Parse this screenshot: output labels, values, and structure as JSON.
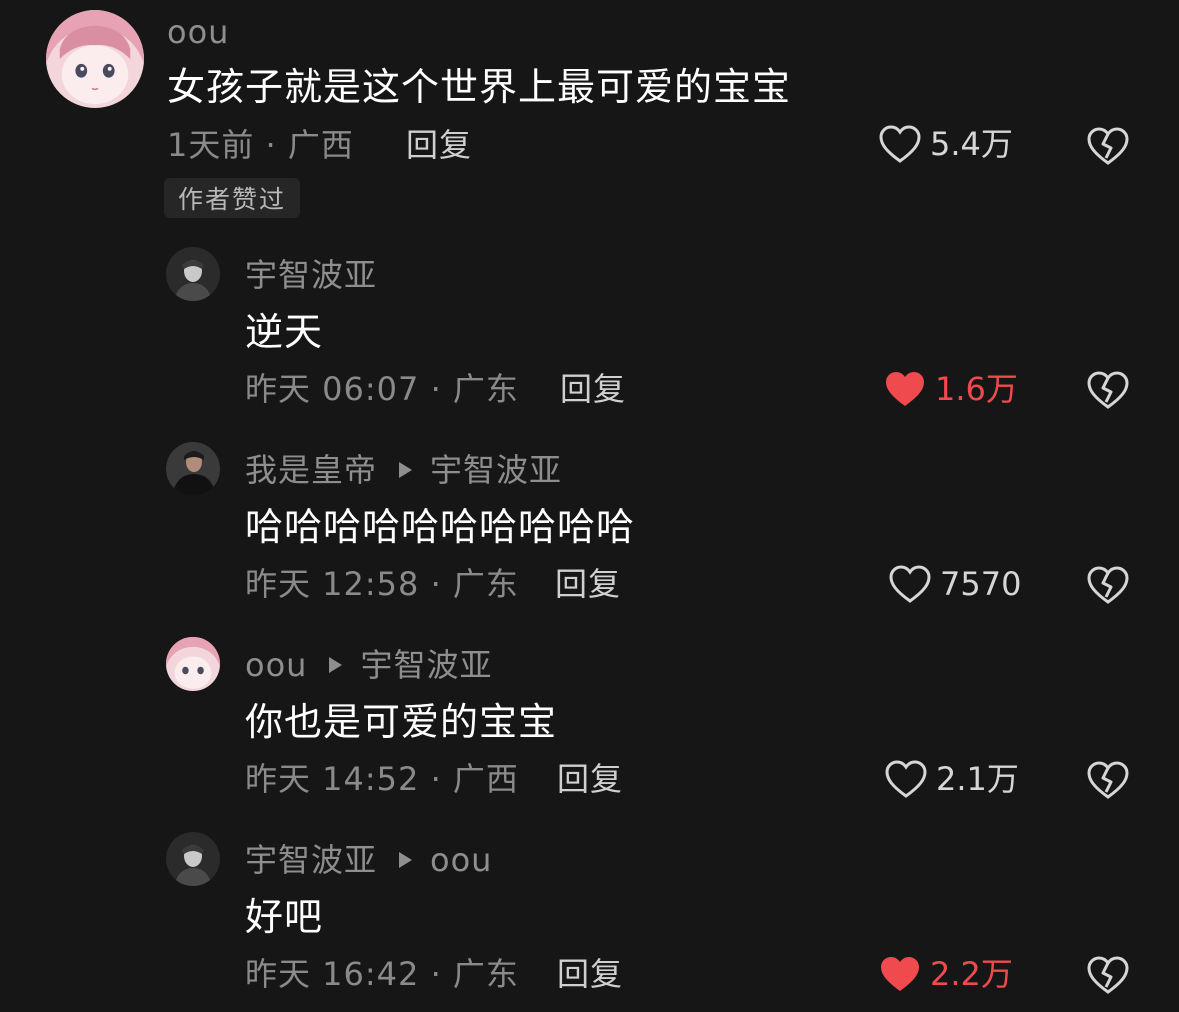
{
  "comments": [
    {
      "username": "oou",
      "content": "女孩子就是这个世界上最可爱的宝宝",
      "meta": "1天前 · 广西",
      "reply": "回复",
      "likes": "5.4万",
      "liked": false,
      "badge": "作者赞过"
    },
    {
      "username": "宇智波亚",
      "content": "逆天",
      "meta": "昨天 06:07 · 广东",
      "reply": "回复",
      "likes": "1.6万",
      "liked": true
    },
    {
      "username": "我是皇帝",
      "reply_to": "宇智波亚",
      "content": "哈哈哈哈哈哈哈哈哈哈",
      "meta": "昨天 12:58 · 广东",
      "reply": "回复",
      "likes": "7570",
      "liked": false
    },
    {
      "username": "oou",
      "reply_to": "宇智波亚",
      "content": "你也是可爱的宝宝",
      "meta": "昨天 14:52 · 广西",
      "reply": "回复",
      "likes": "2.1万",
      "liked": false
    },
    {
      "username": "宇智波亚",
      "reply_to": "oou",
      "content": "好吧",
      "meta": "昨天 16:42 · 广东",
      "reply": "回复",
      "likes": "2.2万",
      "liked": true
    }
  ],
  "colors": {
    "background": "#161616",
    "liked_red": "#ef4a4e",
    "secondary_text": "#8a8a8a"
  }
}
